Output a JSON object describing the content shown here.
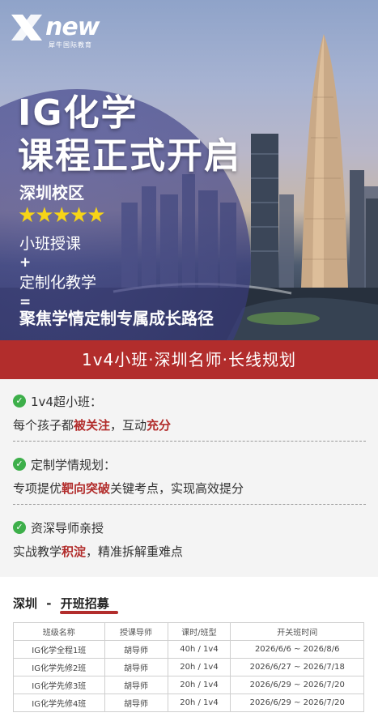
{
  "brand": {
    "name": "new",
    "subtitle": "犀牛国际教育"
  },
  "hero": {
    "title_line1": "IG化学",
    "title_line2": "课程正式开启",
    "campus": "深圳校区",
    "stars": "★★★★★",
    "feature1": "小班授课",
    "plus": "+",
    "feature2": "定制化教学",
    "equals": "=",
    "feature3": "聚焦学情定制专属成长路径"
  },
  "band": {
    "text": "1v4小班·深圳名师·长线规划"
  },
  "features": [
    {
      "title": "1v4超小班：",
      "desc_pre": "每个孩子都",
      "desc_hl1": "被关注",
      "desc_mid": "，互动",
      "desc_hl2": "充分",
      "desc_post": ""
    },
    {
      "title": "定制学情规划：",
      "desc_pre": "专项提优",
      "desc_hl1": "靶向突破",
      "desc_mid": "关键考点，实现高效提分",
      "desc_hl2": "",
      "desc_post": ""
    },
    {
      "title": "资深导师亲授",
      "desc_pre": "实战教学",
      "desc_hl1": "积淀",
      "desc_mid": "，精准拆解重难点",
      "desc_hl2": "",
      "desc_post": ""
    }
  ],
  "schedule": {
    "heading_city": "深圳",
    "heading_sep": "-",
    "heading_label": "开班招募",
    "columns": [
      "班级名称",
      "授课导师",
      "课时/班型",
      "开关班时间"
    ],
    "rows": [
      [
        "IG化学全程1班",
        "胡导师",
        "40h / 1v4",
        "2026/6/6 ~ 2026/8/6"
      ],
      [
        "IG化学先修2班",
        "胡导师",
        "20h / 1v4",
        "2026/6/27 ~ 2026/7/18"
      ],
      [
        "IG化学先修3班",
        "胡导师",
        "20h / 1v4",
        "2026/6/29 ~ 2026/7/20"
      ],
      [
        "IG化学先修4班",
        "胡导师",
        "20h / 1v4",
        "2026/6/29 ~ 2026/7/20"
      ]
    ]
  },
  "colors": {
    "accent_red": "#b22d2c",
    "check_green": "#3daf4a",
    "star_yellow": "#f7d417"
  }
}
